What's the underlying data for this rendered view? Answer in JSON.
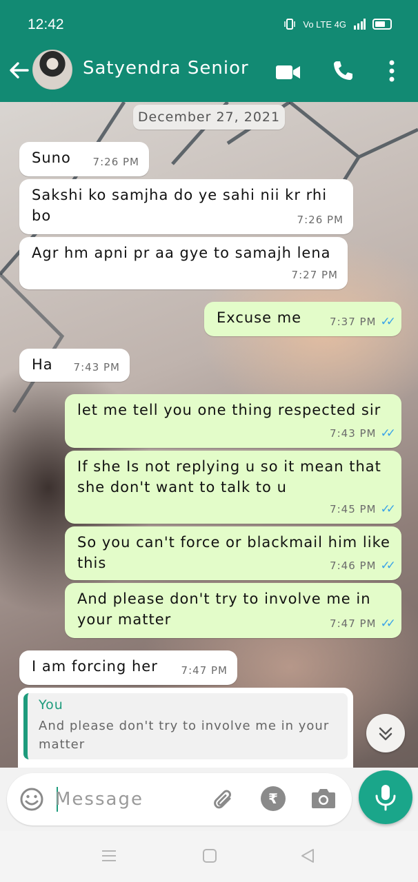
{
  "status_bar": {
    "time": "12:42",
    "network": "Vo LTE 4G"
  },
  "header": {
    "contact_name": "Satyendra Senior",
    "icons": [
      "back-arrow-icon",
      "avatar",
      "video-call-icon",
      "phone-icon",
      "more-vert-icon"
    ]
  },
  "chat": {
    "date_chip": "December 27, 2021",
    "messages": [
      {
        "direction": "incoming",
        "text": "Suno",
        "time": "7:26 PM"
      },
      {
        "direction": "incoming",
        "text": "Sakshi ko samjha do ye sahi nii kr rhi bo",
        "time": "7:26 PM"
      },
      {
        "direction": "incoming",
        "text": "Agr hm apni pr aa gye to samajh lena",
        "time": "7:27 PM"
      },
      {
        "direction": "outgoing",
        "text": "Excuse me",
        "time": "7:37 PM",
        "status": "read"
      },
      {
        "direction": "incoming",
        "text": "Ha",
        "time": "7:43 PM"
      },
      {
        "direction": "outgoing",
        "text": "let me tell you one thing respected sir",
        "time": "7:43 PM",
        "status": "read"
      },
      {
        "direction": "outgoing",
        "text": "If she Is not replying u so it mean that she don't want to talk to u",
        "time": "7:45 PM",
        "status": "read"
      },
      {
        "direction": "outgoing",
        "text": "So you can't force or blackmail him like this",
        "time": "7:46 PM",
        "status": "read"
      },
      {
        "direction": "outgoing",
        "text": "And please don't try to involve me in your matter",
        "time": "7:47 PM",
        "status": "read"
      },
      {
        "direction": "incoming",
        "text": "I am forcing her",
        "time": "7:47 PM"
      }
    ],
    "quoted_reply": {
      "author": "You",
      "text": "And please don't try to involve me in your matter"
    }
  },
  "input_bar": {
    "placeholder": "Message",
    "value": "",
    "icons": [
      "emoji-icon",
      "attach-icon",
      "rupee-payment-icon",
      "camera-icon",
      "mic-icon"
    ]
  },
  "colors": {
    "header": "#128a73",
    "incoming_bubble": "#ffffff",
    "outgoing_bubble": "#e3fcc9",
    "read_ticks": "#3aa3e8",
    "accent": "#1aa68a"
  }
}
